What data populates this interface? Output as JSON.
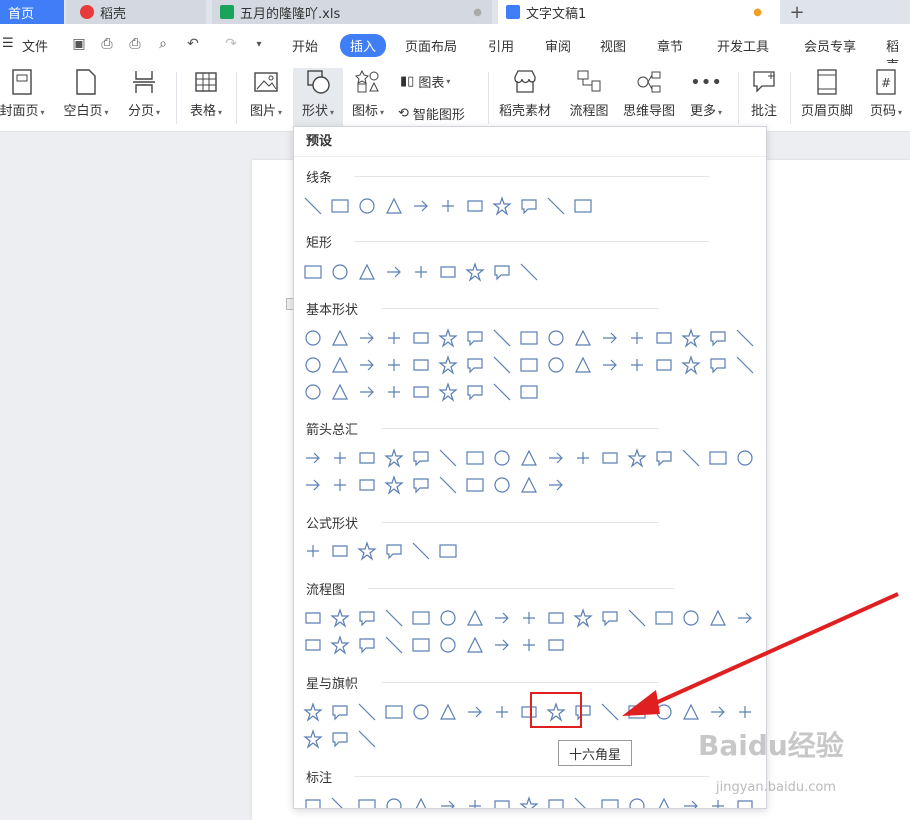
{
  "tabs": {
    "home": "首页",
    "daoke": "稻壳",
    "xls": "五月的隆隆吖.xls",
    "doc": "文字文稿1",
    "add": "+"
  },
  "menu": {
    "file": "文件",
    "items": [
      "开始",
      "插入",
      "页面布局",
      "引用",
      "审阅",
      "视图",
      "章节",
      "开发工具",
      "会员专享",
      "稻壳"
    ]
  },
  "ribbon": {
    "cover": "封面页",
    "blank": "空白页",
    "break": "分页",
    "table": "表格",
    "picture": "图片",
    "shape": "形状",
    "icon": "图标",
    "chart": "图表",
    "smart": "智能图形",
    "material": "稻壳素材",
    "flowchart": "流程图",
    "mindmap": "思维导图",
    "more": "更多",
    "comment": "批注",
    "header_footer": "页眉页脚",
    "page_num": "页码"
  },
  "dropdown": {
    "title": "预设",
    "categories": [
      "线条",
      "矩形",
      "基本形状",
      "箭头总汇",
      "公式形状",
      "流程图",
      "星与旗帜",
      "标注"
    ]
  },
  "tooltip": "十六角星",
  "watermark": {
    "brand": "Baidu经验",
    "url": "jingyan.baidu.com"
  },
  "colors": {
    "accent": "#3f7ef7",
    "shape_stroke": "#5b7fb5",
    "highlight": "#e02020"
  }
}
